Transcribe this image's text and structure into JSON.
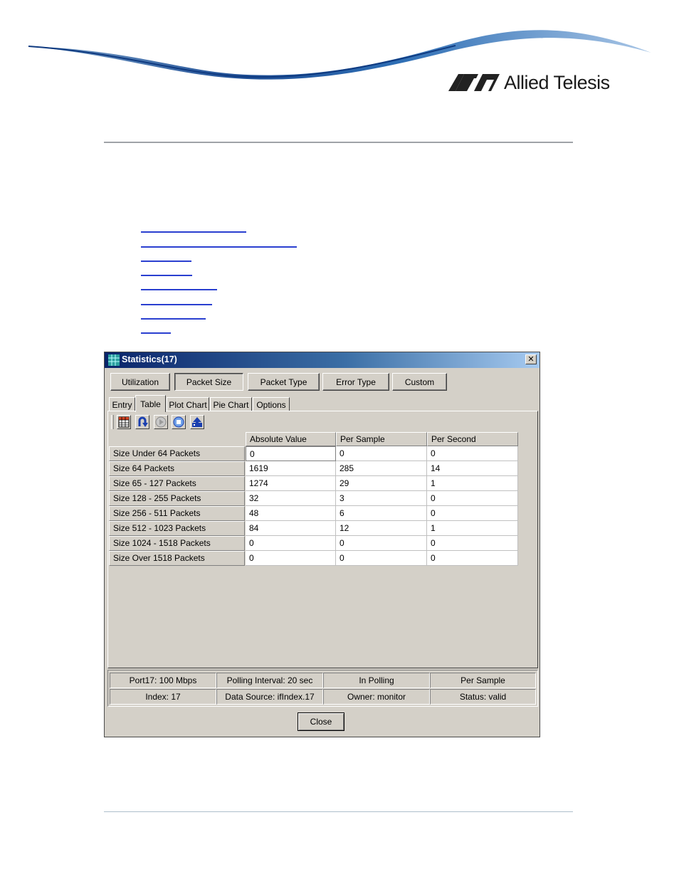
{
  "brand": {
    "name": "Allied Telesis"
  },
  "doc": {
    "link_count": 8
  },
  "window": {
    "title": "Statistics(17)",
    "close_glyph": "✕"
  },
  "categories": [
    {
      "label": "Utilization",
      "selected": false
    },
    {
      "label": "Packet Size",
      "selected": true
    },
    {
      "label": "Packet Type",
      "selected": false
    },
    {
      "label": "Error Type",
      "selected": false
    },
    {
      "label": "Custom",
      "selected": false
    }
  ],
  "tabs": [
    {
      "label": "Entry",
      "active": false
    },
    {
      "label": "Table",
      "active": true
    },
    {
      "label": "Plot Chart",
      "active": false
    },
    {
      "label": "Pie Chart",
      "active": false
    },
    {
      "label": "Options",
      "active": false
    }
  ],
  "toolbar": {
    "icons": [
      "table-grid-icon",
      "refresh-icon",
      "play-icon",
      "stop-icon",
      "save-upload-icon"
    ]
  },
  "table": {
    "columns": [
      "Absolute Value",
      "Per Sample",
      "Per Second"
    ],
    "rows": [
      {
        "label": "Size Under 64 Packets",
        "values": [
          "0",
          "0",
          "0"
        ]
      },
      {
        "label": "Size 64 Packets",
        "values": [
          "1619",
          "285",
          "14"
        ]
      },
      {
        "label": "Size 65 - 127 Packets",
        "values": [
          "1274",
          "29",
          "1"
        ]
      },
      {
        "label": "Size 128 - 255 Packets",
        "values": [
          "32",
          "3",
          "0"
        ]
      },
      {
        "label": "Size 256 - 511 Packets",
        "values": [
          "48",
          "6",
          "0"
        ]
      },
      {
        "label": "Size 512 - 1023 Packets",
        "values": [
          "84",
          "12",
          "1"
        ]
      },
      {
        "label": "Size 1024 - 1518 Packets",
        "values": [
          "0",
          "0",
          "0"
        ]
      },
      {
        "label": "Size Over 1518 Packets",
        "values": [
          "0",
          "0",
          "0"
        ]
      }
    ]
  },
  "status": {
    "row1": [
      "Port17: 100 Mbps",
      "Polling Interval: 20 sec",
      "In Polling",
      "Per Sample"
    ],
    "row2": [
      "Index: 17",
      "Data Source: ifIndex.17",
      "Owner: monitor",
      "Status: valid"
    ]
  },
  "footer": {
    "close_label": "Close"
  }
}
